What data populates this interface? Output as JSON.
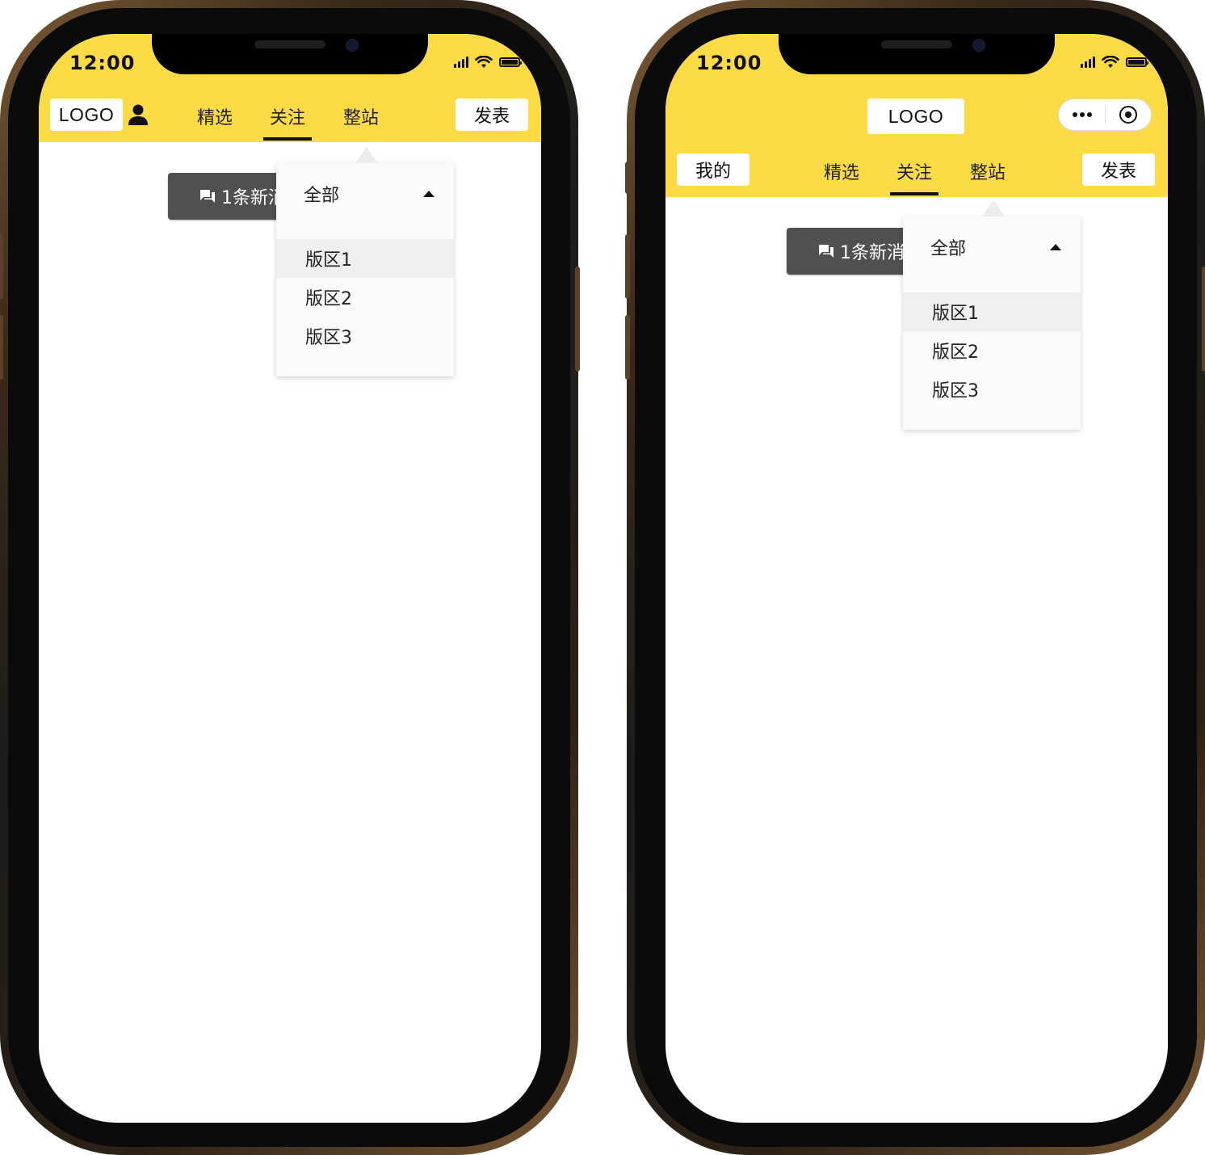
{
  "colors": {
    "header_yellow": "#fddb45",
    "message_button": "#505050",
    "dropdown_bg": "#fafafa",
    "active_row": "#efefef"
  },
  "phone1": {
    "status_time": "12:00",
    "logo": "LOGO",
    "profile_icon": "person-icon",
    "tabs": [
      "精选",
      "关注",
      "整站"
    ],
    "active_tab": "关注",
    "publish_button": "发表",
    "message_button": "1条新消",
    "dropdown": {
      "header": "全部",
      "items": [
        "版区1",
        "版区2",
        "版区3"
      ],
      "selected": "版区1"
    }
  },
  "phone2": {
    "status_time": "12:00",
    "logo": "LOGO",
    "mine_button": "我的",
    "tabs": [
      "精选",
      "关注",
      "整站"
    ],
    "active_tab": "关注",
    "publish_button": "发表",
    "capsule_icons": [
      "more-dots-icon",
      "close-target-icon"
    ],
    "message_button": "1条新消",
    "dropdown": {
      "header": "全部",
      "items": [
        "版区1",
        "版区2",
        "版区3"
      ],
      "selected": "版区1"
    }
  }
}
